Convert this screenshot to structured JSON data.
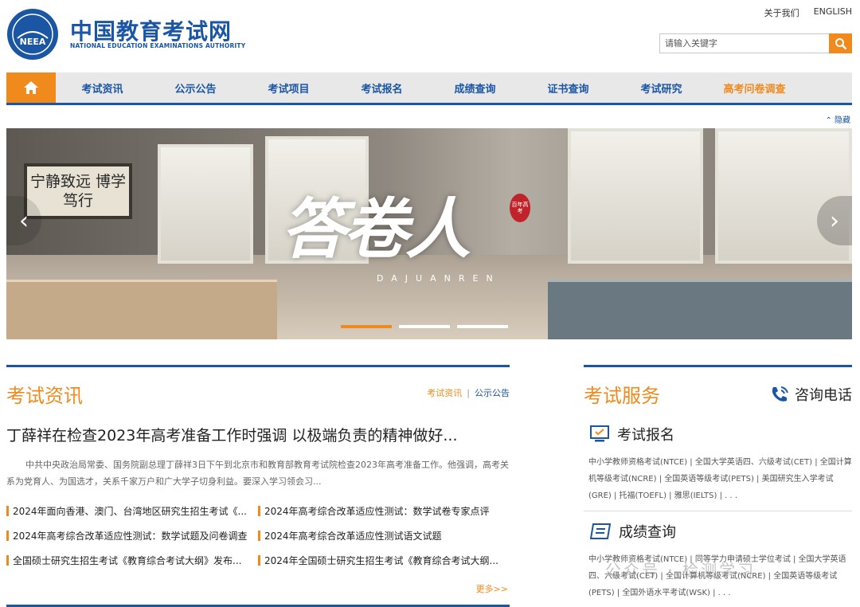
{
  "header": {
    "logo_cn": "中国教育考试网",
    "logo_en": "NATIONAL EDUCATION EXAMINATIONS AUTHORITY",
    "emblem_text": "NEEA",
    "top_links": [
      "关于我们",
      "ENGLISH"
    ],
    "search_placeholder": "请输入关键字"
  },
  "nav": {
    "items": [
      "考试资讯",
      "公示公告",
      "考试项目",
      "考试报名",
      "成绩查询",
      "证书查询",
      "考试研究",
      "高考问卷调查"
    ],
    "hide_label": "隐藏"
  },
  "banner": {
    "plaque_text": "宁静致远 博学笃行",
    "title": "答卷人",
    "subtitle": "DAJUANREN",
    "seal_text": "百年高考",
    "slide_count": 3,
    "active_slide": 0
  },
  "news": {
    "title": "考试资讯",
    "tabs": [
      "考试资讯",
      "公示公告"
    ],
    "headline": "丁薛祥在检查2023年高考准备工作时强调 以极端负责的精神做好...",
    "summary": "中共中央政治局常委、国务院副总理丁薛祥3日下午到北京市和教育部教育考试院检查2023年高考准备工作。他强调，高考关系为党育人、为国选才，关系千家万户和广大学子切身利益。要深入学习领会习...",
    "items": [
      "2024年面向香港、澳门、台湾地区研究生招生考试《...",
      "2024年高考综合改革适应性测试：数学试卷专家点评",
      "2024年高考综合改革适应性测试：数学试题及问卷调查",
      "2024年高考综合改革适应性测试语文试题",
      "全国硕士研究生招生考试《教育综合考试大纲》发布...",
      "2024年全国硕士研究生招生考试《教育综合考试大纲..."
    ],
    "more_label": "更多>>"
  },
  "service": {
    "title": "考试服务",
    "hotline": "咨询电话",
    "blocks": [
      {
        "title": "考试报名",
        "links": "中小学教师资格考试(NTCE) | 全国大学英语四、六级考试(CET) | 全国计算机等级考试(NCRE) | 全国英语等级考试(PETS) | 美国研究生入学考试(GRE) | 托福(TOEFL) | 雅思(IELTS) | . . ."
      },
      {
        "title": "成绩查询",
        "links": "中小学教师资格考试(NTCE) | 同等学力申请硕士学位考试 | 全国大学英语四、六级考试(CET) | 全国计算机等级考试(NCRE) | 全国英语等级考试(PETS) | 全国外语水平考试(WSK) | . . ."
      }
    ]
  },
  "watermark": "公众号 · 检测学习",
  "colors": {
    "brand_blue": "#1a56a3",
    "accent_orange": "#f08a1c"
  }
}
